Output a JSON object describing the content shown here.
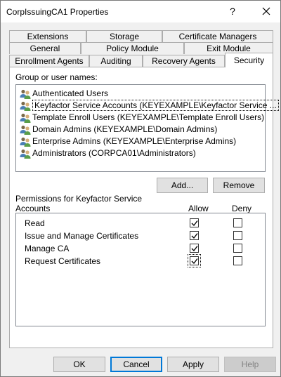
{
  "window": {
    "title": "CorpIssuingCA1 Properties",
    "help_label": "?"
  },
  "tabs": {
    "row1": [
      "Extensions",
      "Storage",
      "Certificate Managers"
    ],
    "row2": [
      "General",
      "Policy Module",
      "Exit Module"
    ],
    "row3": [
      "Enrollment Agents",
      "Auditing",
      "Recovery Agents",
      "Security"
    ],
    "active": "Security"
  },
  "security": {
    "group_label": "Group or user names:",
    "users": [
      {
        "name": "Authenticated Users",
        "icon": "users-group-icon",
        "selected": false
      },
      {
        "name": "Keyfactor Service Accounts (KEYEXAMPLE\\Keyfactor Service ...",
        "icon": "users-group-icon",
        "selected": true
      },
      {
        "name": "Template Enroll Users (KEYEXAMPLE\\Template Enroll Users)",
        "icon": "users-group-icon",
        "selected": false
      },
      {
        "name": "Domain Admins (KEYEXAMPLE\\Domain Admins)",
        "icon": "users-group-icon",
        "selected": false
      },
      {
        "name": "Enterprise Admins (KEYEXAMPLE\\Enterprise Admins)",
        "icon": "users-group-icon",
        "selected": false
      },
      {
        "name": "Administrators (CORPCA01\\Administrators)",
        "icon": "users-group-icon",
        "selected": false
      }
    ],
    "add_label": "Add...",
    "remove_label": "Remove",
    "permissions_label_line1": "Permissions for Keyfactor Service",
    "permissions_label_line2": "Accounts",
    "allow_header": "Allow",
    "deny_header": "Deny",
    "permissions": [
      {
        "name": "Read",
        "allow": true,
        "deny": false
      },
      {
        "name": "Issue and Manage Certificates",
        "allow": true,
        "deny": false
      },
      {
        "name": "Manage CA",
        "allow": true,
        "deny": false
      },
      {
        "name": "Request Certificates",
        "allow": true,
        "deny": false
      }
    ]
  },
  "footer": {
    "ok_label": "OK",
    "cancel_label": "Cancel",
    "apply_label": "Apply",
    "help_label": "Help"
  },
  "colors": {
    "accent": "#0078d7",
    "background": "#f0f0f0"
  }
}
